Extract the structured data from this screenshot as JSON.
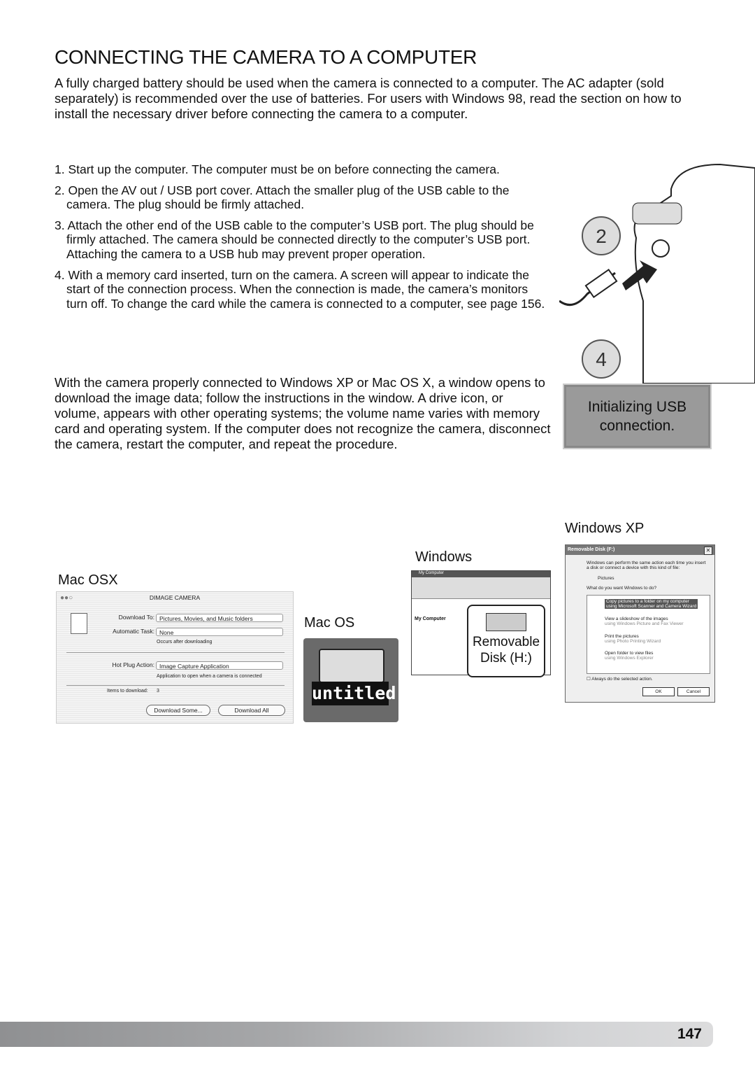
{
  "title": "CONNECTING THE CAMERA TO A COMPUTER",
  "intro": "A fully charged battery should be used when the camera is connected to a computer. The  AC adapter (sold separately) is recommended over the use of batteries. For users with Windows 98, read the section on how to install the necessary driver before connecting the camera to a computer.",
  "steps": [
    "1. Start up the computer. The computer must be on before connecting the camera.",
    "2. Open the AV out / USB port cover. Attach the smaller plug of the USB cable to the camera. The plug should be firmly attached.",
    "3. Attach the other end of the USB cable to the computer’s USB port. The plug should be firmly attached. The camera should be connected directly to the computer’s USB port. Attaching the camera to a USB hub may prevent proper operation.",
    "4. With a memory card inserted, turn on the camera. A screen will appear to indicate the start of the connection process. When the connection is made, the camera’s monitors turn off. To change the card while the camera is connected to a computer, see page 156."
  ],
  "after": "With the camera properly connected to Windows XP or Mac OS X, a window opens to download the image data; follow the instructions in the window. A drive icon, or volume, appears with other operating systems; the volume name varies with memory card and operating system. If the computer does not recognize the camera, disconnect the camera, restart the computer, and repeat the procedure.",
  "illustration": {
    "callouts": [
      "2",
      "4"
    ]
  },
  "status": {
    "line1": "Initializing USB",
    "line2": "connection."
  },
  "labels": {
    "winxp": "Windows XP",
    "windows": "Windows",
    "macosx": "Mac OSX",
    "macos": "Mac OS"
  },
  "mac_dialog": {
    "title": "DIMAGE CAMERA",
    "download_to_label": "Download To:",
    "download_to": "Pictures, Movies, and Music folders",
    "task_label": "Automatic Task:",
    "task": "None",
    "task_note": "Occurs after downloading",
    "hotplug_label": "Hot Plug Action:",
    "hotplug": "Image Capture Application",
    "hotplug_note": "Application to open when a camera is connected",
    "items_label": "Items to download:",
    "items": "3",
    "btn_some": "Download Some...",
    "btn_all": "Download All"
  },
  "macos_icon": {
    "label": "untitled"
  },
  "win_window": {
    "title": "My Computer",
    "panel": "My Computer",
    "callout_line1": "Removable",
    "callout_line2": "Disk (H:)"
  },
  "xp_dialog": {
    "title": "Removable Disk (F:)",
    "intro": "Windows can perform the same action each time you insert a disk or connect a device with this kind of file:",
    "type": "Pictures",
    "question": "What do you want Windows to do?",
    "options": [
      {
        "main": "Copy pictures to a folder on my computer",
        "sub": "using Microsoft Scanner and Camera Wizard"
      },
      {
        "main": "View a slideshow of the images",
        "sub": "using Windows Picture and Fax Viewer"
      },
      {
        "main": "Print the pictures",
        "sub": "using Photo Printing Wizard"
      },
      {
        "main": "Open folder to view files",
        "sub": "using Windows Explorer"
      }
    ],
    "always": "Always do the selected action.",
    "ok": "OK",
    "cancel": "Cancel"
  },
  "page_number": "147"
}
